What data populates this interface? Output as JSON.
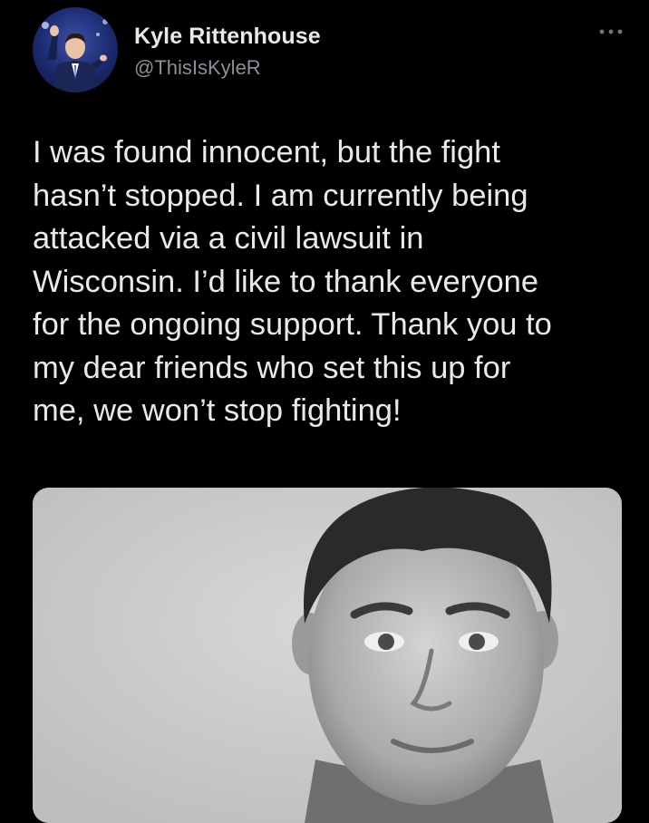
{
  "tweet": {
    "author_name": "Kyle Rittenhouse",
    "author_handle": "@ThisIsKyleR",
    "more_icon": "more-horizontal-icon",
    "text": "I was found innocent, but the fight\nhasn’t stopped. I am currently being\nattacked via a civil lawsuit in\nWisconsin. I’d like to thank everyone\nfor the ongoing support. Thank you to\nmy dear friends who set this up for\nme, we won’t stop fighting!"
  },
  "colors": {
    "background": "#000000",
    "primary_text": "#e7e9ea",
    "secondary_text": "#8b9096",
    "avatar_background": "#1b2a6e",
    "media_background": "#cfcfcf"
  }
}
